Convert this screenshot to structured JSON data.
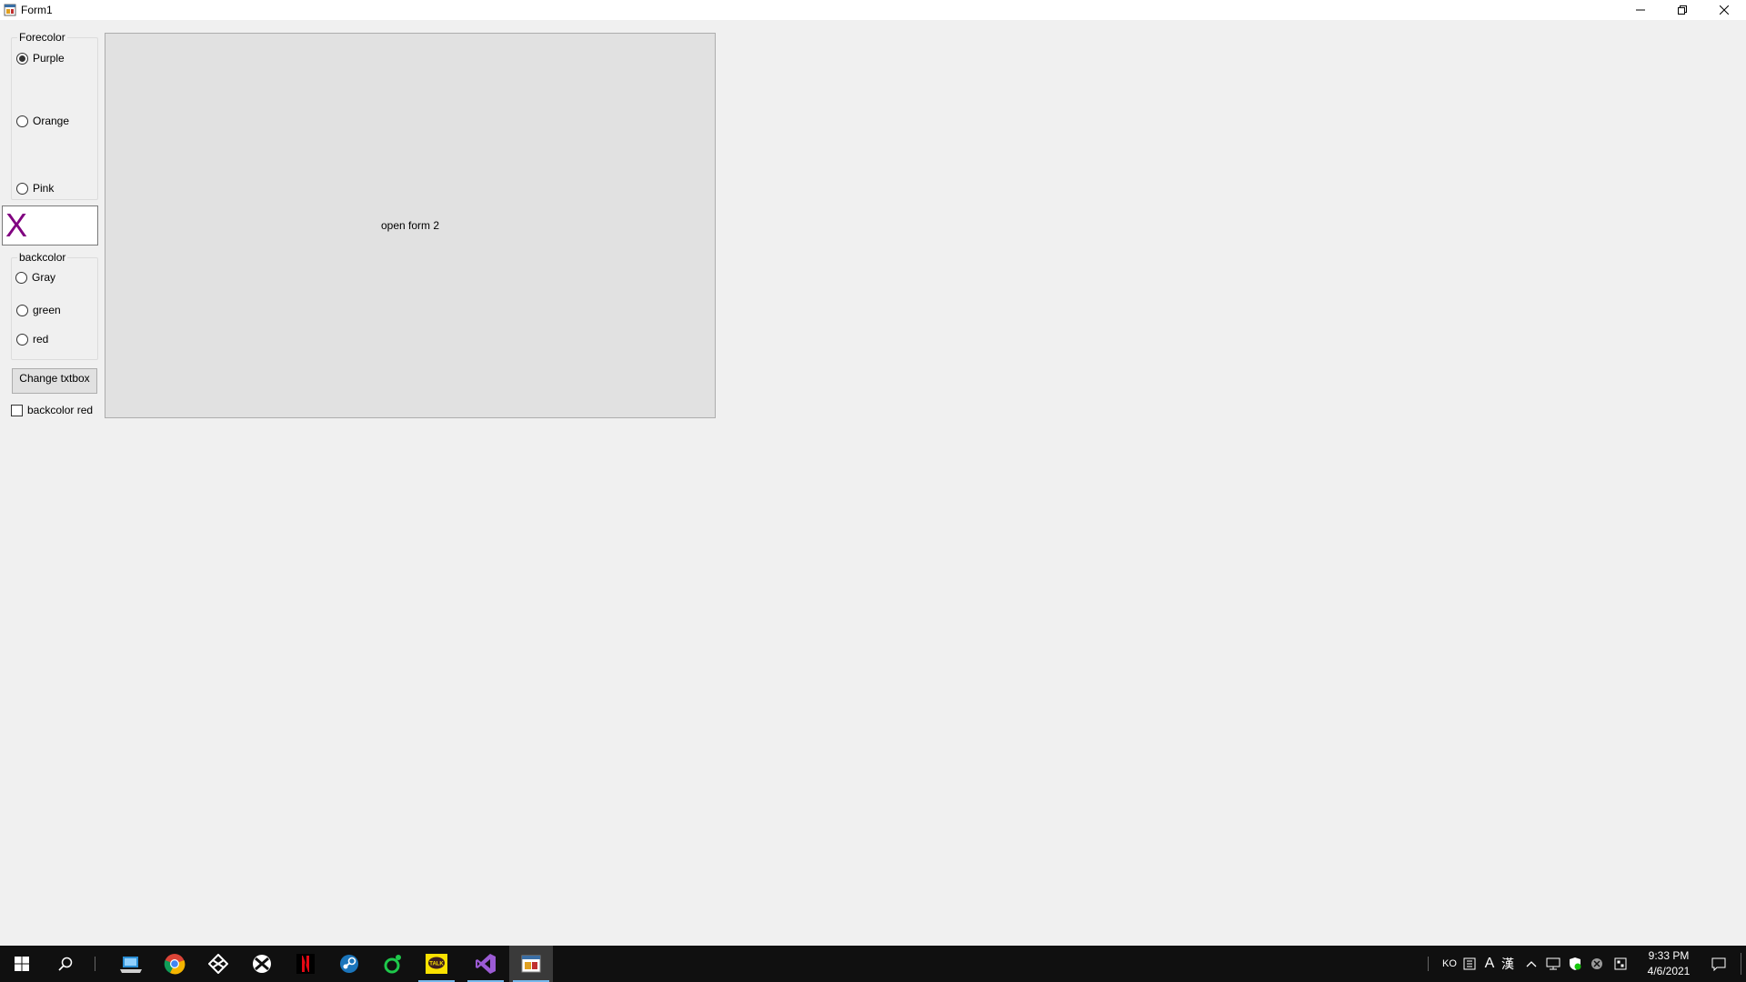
{
  "window": {
    "title": "Form1",
    "controls": {
      "minimize": "minimize-icon",
      "maximize": "restore-icon",
      "close": "close-icon"
    }
  },
  "forecolor_group": {
    "label": "Forecolor",
    "options": [
      {
        "label": "Purple",
        "checked": true
      },
      {
        "label": "Orange",
        "checked": false
      },
      {
        "label": "Pink",
        "checked": false
      }
    ]
  },
  "textbox": {
    "value": "X",
    "forecolor": "#800080"
  },
  "backcolor_group": {
    "label": "backcolor",
    "options": [
      {
        "label": "Gray",
        "checked": false
      },
      {
        "label": "green",
        "checked": false
      },
      {
        "label": "red",
        "checked": false
      }
    ]
  },
  "change_button": {
    "label": "Change txtbox"
  },
  "backcolor_checkbox": {
    "label": "backcolor red",
    "checked": false
  },
  "open_form_button": {
    "label": "open form 2"
  },
  "taskbar": {
    "apps": [
      "start-icon",
      "search-icon",
      "file-explorer-icon",
      "chrome-icon",
      "app-icon",
      "xbox-icon",
      "netflix-icon",
      "steam-icon",
      "app-green-icon",
      "kakaotalk-icon",
      "visual-studio-icon",
      "form-app-icon"
    ],
    "tray": {
      "language": "KO",
      "ime": "A",
      "hanja": "漢",
      "time": "9:33 PM",
      "date": "4/6/2021"
    }
  },
  "colors": {
    "window_bg": "#f0f0f0",
    "taskbar_bg": "#101010",
    "accent": "#76b9ed"
  }
}
